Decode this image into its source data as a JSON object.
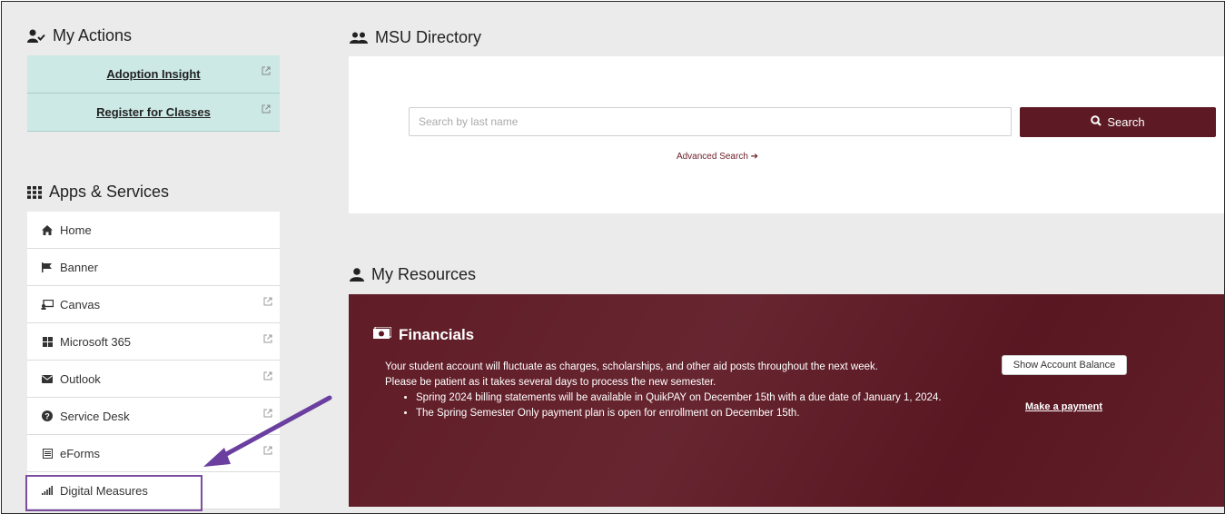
{
  "my_actions": {
    "title": "My Actions",
    "items": [
      {
        "label": "Adoption Insight"
      },
      {
        "label": "Register for Classes"
      }
    ]
  },
  "apps_services": {
    "title": "Apps & Services",
    "items": [
      {
        "label": "Home",
        "icon": "home-icon"
      },
      {
        "label": "Banner",
        "icon": "flag-icon"
      },
      {
        "label": "Canvas",
        "icon": "canvas-icon"
      },
      {
        "label": "Microsoft 365",
        "icon": "grid-icon"
      },
      {
        "label": "Outlook",
        "icon": "envelope-icon"
      },
      {
        "label": "Service Desk",
        "icon": "question-circle-icon"
      },
      {
        "label": "eForms",
        "icon": "form-icon"
      },
      {
        "label": "Digital Measures",
        "icon": "signal-bars-icon"
      }
    ]
  },
  "directory": {
    "title": "MSU Directory",
    "search_placeholder": "Search by last name",
    "search_button": "Search",
    "advanced_search": "Advanced Search ➔"
  },
  "resources": {
    "title": "My Resources",
    "financials": {
      "title": "Financials",
      "line1": "Your student account will fluctuate as charges, scholarships, and other aid posts throughout the next week.",
      "line2": "Please be patient as it takes several days to process the new semester.",
      "bullets": [
        "Spring 2024 billing statements will be available in QuikPAY on December 15th with a due date of January 1, 2024.",
        "The Spring Semester Only payment plan is open for enrollment on December 15th."
      ],
      "balance_button": "Show Account Balance",
      "payment_link": "Make a payment"
    }
  },
  "colors": {
    "maroon": "#5e1a24",
    "teal_bg": "#cce9e6",
    "highlight": "#7b4ca0"
  }
}
